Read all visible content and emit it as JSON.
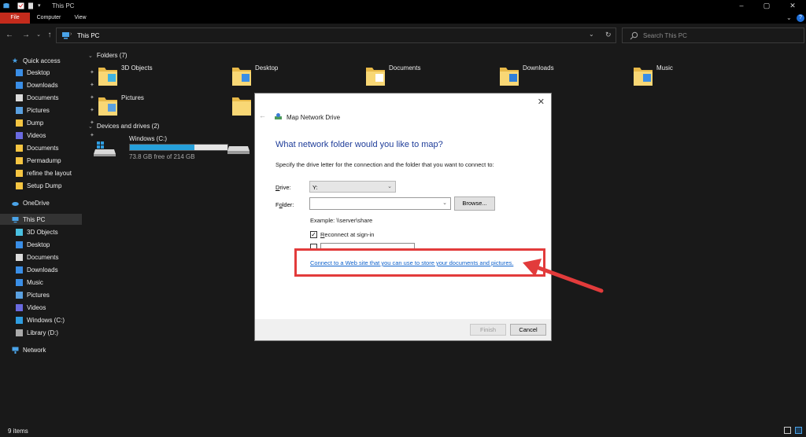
{
  "window": {
    "title": "This PC",
    "controls": {
      "minimize": "–",
      "maximize": "▢",
      "close": "✕"
    }
  },
  "ribbon": {
    "tabs": [
      "File",
      "Computer",
      "View"
    ],
    "help": "?"
  },
  "address_bar": {
    "path": "This PC",
    "search_placeholder": "Search This PC"
  },
  "nav": {
    "quick_access": "Quick access",
    "quick_items": [
      {
        "label": "Desktop",
        "pinned": true
      },
      {
        "label": "Downloads",
        "pinned": true
      },
      {
        "label": "Documents",
        "pinned": true
      },
      {
        "label": "Pictures",
        "pinned": true
      },
      {
        "label": "Dump",
        "pinned": true
      },
      {
        "label": "Videos",
        "pinned": true
      },
      {
        "label": "Documents",
        "pinned": false
      },
      {
        "label": "Permadump",
        "pinned": false
      },
      {
        "label": "refine the layout",
        "pinned": false
      },
      {
        "label": "Setup Dump",
        "pinned": false
      }
    ],
    "onedrive": "OneDrive",
    "this_pc": "This PC",
    "this_pc_items": [
      "3D Objects",
      "Desktop",
      "Documents",
      "Downloads",
      "Music",
      "Pictures",
      "Videos",
      "Windows (C:)",
      "Library (D:)"
    ],
    "network": "Network"
  },
  "main": {
    "folders_header": "Folders (7)",
    "folders": [
      "3D Objects",
      "Desktop",
      "Documents",
      "Downloads",
      "Music",
      "Pictures"
    ],
    "devices_header": "Devices and drives (2)",
    "drive_c": {
      "label": "Windows (C:)",
      "free_text": "73.8 GB free of 214 GB",
      "used_fraction": 0.66
    }
  },
  "status": {
    "items": "9 items"
  },
  "dialog": {
    "title": "Map Network Drive",
    "close": "✕",
    "heading": "What network folder would you like to map?",
    "description": "Specify the drive letter for the connection and the folder that you want to connect to:",
    "drive_label_u": "D",
    "drive_label_rest": "rive:",
    "drive_value": "Y:",
    "folder_label_rest1": "F",
    "folder_label_u": "o",
    "folder_label_rest2": "lder:",
    "folder_value": "",
    "browse": "Browse...",
    "example": "Example: \\\\server\\share",
    "reconnect_u": "R",
    "reconnect_rest": "econnect at sign-in",
    "link": "Connect to a Web site that you can use to store your documents and pictures.",
    "finish": "Finish",
    "cancel": "Cancel"
  },
  "colors": {
    "accent_file_tab": "#c42b1c",
    "drive_bar": "#26a0da",
    "annotation": "#e23b3b",
    "link": "#0f62cc"
  }
}
